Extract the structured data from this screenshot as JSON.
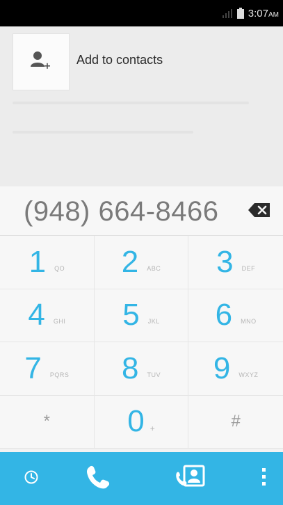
{
  "status_bar": {
    "time": "3:07",
    "ampm": "AM",
    "icons": [
      "signal-icon",
      "battery-icon"
    ]
  },
  "suggestion": {
    "add_to_contacts_label": "Add to contacts",
    "avatar_icon": "add-person-icon"
  },
  "dialer": {
    "number": "(948) 664-8466",
    "backspace_icon": "backspace-icon"
  },
  "keypad": {
    "keys": [
      {
        "digit": "1",
        "letters": "QO"
      },
      {
        "digit": "2",
        "letters": "ABC"
      },
      {
        "digit": "3",
        "letters": "DEF"
      },
      {
        "digit": "4",
        "letters": "GHI"
      },
      {
        "digit": "5",
        "letters": "JKL"
      },
      {
        "digit": "6",
        "letters": "MNO"
      },
      {
        "digit": "7",
        "letters": "PQRS"
      },
      {
        "digit": "8",
        "letters": "TUV"
      },
      {
        "digit": "9",
        "letters": "WXYZ"
      },
      {
        "symbol": "*"
      },
      {
        "digit": "0",
        "letters": "+"
      },
      {
        "symbol": "#"
      }
    ]
  },
  "action_bar": {
    "buttons": [
      "history-icon",
      "call-icon",
      "contacts-icon",
      "overflow-menu-icon"
    ]
  },
  "colors": {
    "accent": "#33b5e5",
    "status_bar": "#000000"
  }
}
